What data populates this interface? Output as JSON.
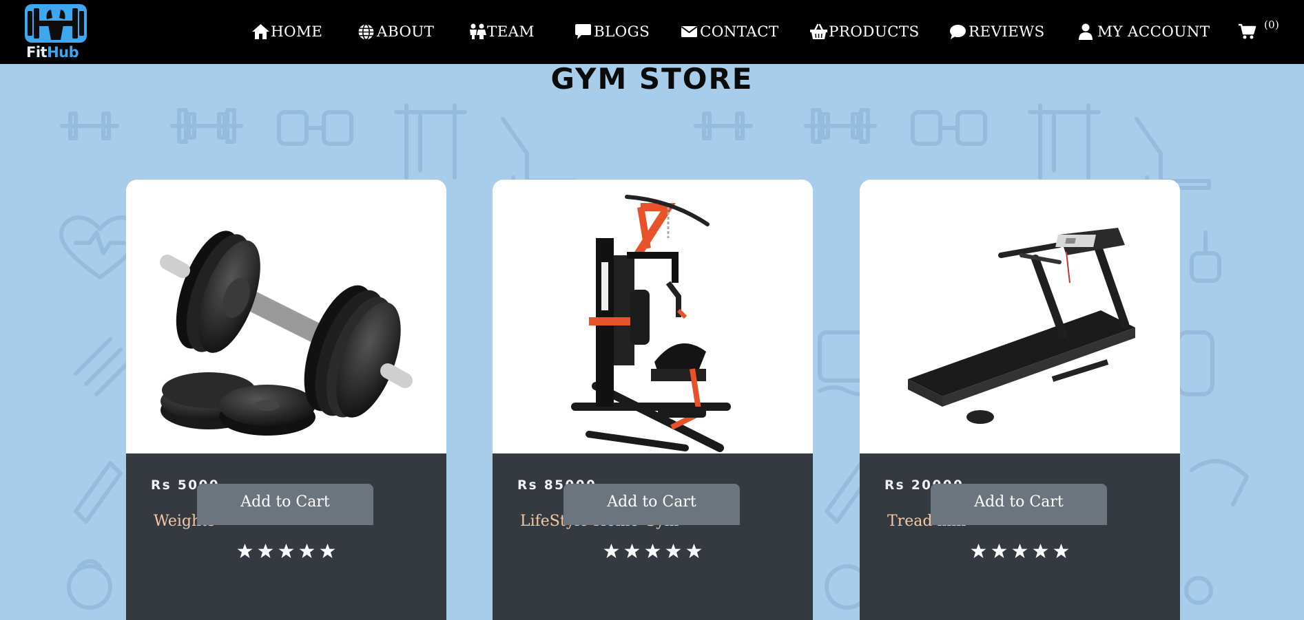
{
  "brand": {
    "name_part1": "Fit",
    "name_part2": "Hub",
    "color_primary": "#3da8f0"
  },
  "nav": {
    "items": [
      {
        "label": "HOME",
        "icon": "home-icon"
      },
      {
        "label": "ABOUT",
        "icon": "globe-icon"
      },
      {
        "label": "TEAM",
        "icon": "people-icon"
      },
      {
        "label": "BLOGS",
        "icon": "comment-box-icon"
      },
      {
        "label": "CONTACT",
        "icon": "envelope-icon"
      },
      {
        "label": "PRODUCTS",
        "icon": "basket-icon"
      },
      {
        "label": "REVIEWS",
        "icon": "speech-bubble-icon"
      },
      {
        "label": "MY ACCOUNT",
        "icon": "user-icon"
      }
    ],
    "cart": {
      "icon": "shopping-cart-icon",
      "count": "(0)"
    }
  },
  "page": {
    "title": "GYM STORE",
    "background_color": "#a8cdea"
  },
  "products": [
    {
      "price": "Rs 5000",
      "name": "Weights",
      "rating": 5,
      "rating_max": 5,
      "button_label": "Add to Cart",
      "image": "dumbbell-weights-image"
    },
    {
      "price": "Rs 85000",
      "name": "LifeStyle Home Gym",
      "rating": 5,
      "rating_max": 5,
      "button_label": "Add to Cart",
      "image": "home-gym-machine-image"
    },
    {
      "price": "Rs 20000",
      "name": "Tread mill",
      "rating": 5,
      "rating_max": 5,
      "button_label": "Add to Cart",
      "image": "treadmill-image"
    }
  ],
  "colors": {
    "card_body": "#343a40",
    "product_name": "#f6c8a4",
    "button": "#6c757d",
    "navbar": "#000000"
  }
}
